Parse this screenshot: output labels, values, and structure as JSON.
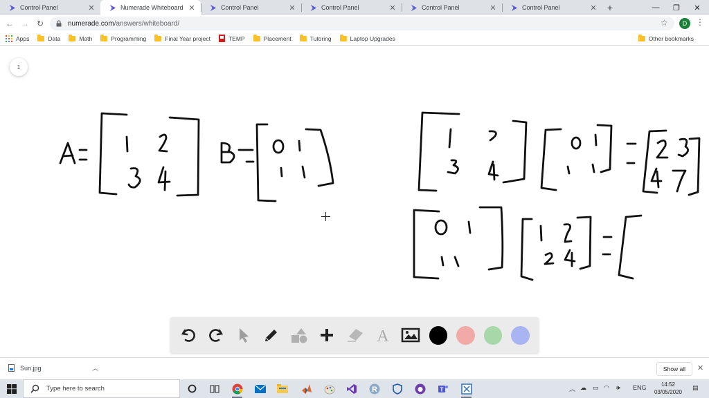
{
  "browser": {
    "tabs": [
      {
        "title": "Control Panel",
        "active": false
      },
      {
        "title": "Numerade Whiteboard",
        "active": true
      },
      {
        "title": "Control Panel",
        "active": false
      },
      {
        "title": "Control Panel",
        "active": false
      },
      {
        "title": "Control Panel",
        "active": false
      },
      {
        "title": "Control Panel",
        "active": false
      }
    ],
    "address": {
      "host": "numerade.com",
      "path": "/answers/whiteboard/"
    },
    "profile_initial": "D",
    "bookmarks": [
      {
        "label": "Apps",
        "icon": "apps-grid-icon"
      },
      {
        "label": "Data",
        "icon": "folder-icon"
      },
      {
        "label": "Math",
        "icon": "folder-icon"
      },
      {
        "label": "Programming",
        "icon": "folder-icon"
      },
      {
        "label": "Final Year project",
        "icon": "folder-icon"
      },
      {
        "label": "TEMP",
        "icon": "bookmark-icon"
      },
      {
        "label": "Placement",
        "icon": "folder-icon"
      },
      {
        "label": "Tutoring",
        "icon": "folder-icon"
      },
      {
        "label": "Laptop Upgrades",
        "icon": "folder-icon"
      }
    ],
    "other_bookmarks": "Other bookmarks"
  },
  "whiteboard": {
    "page_number": "1",
    "handwriting": {
      "matrix_a_label": "A",
      "matrix_a": [
        "1",
        "2",
        "3",
        "4"
      ],
      "matrix_b_label": "B",
      "matrix_b": [
        "0",
        "1",
        "1",
        "1"
      ],
      "product_ab_result": [
        "2",
        "3",
        "4",
        "7"
      ],
      "product_ba_left": [
        "0",
        "1",
        "1",
        "1"
      ],
      "product_ba_right": [
        "1",
        "2",
        "3",
        "4"
      ]
    },
    "tools": [
      {
        "name": "undo-icon",
        "enabled": true
      },
      {
        "name": "redo-icon",
        "enabled": true
      },
      {
        "name": "select-pointer-icon",
        "enabled": false
      },
      {
        "name": "pencil-icon",
        "enabled": true
      },
      {
        "name": "shapes-icon",
        "enabled": false
      },
      {
        "name": "plus-icon",
        "enabled": true
      },
      {
        "name": "eraser-icon",
        "enabled": false
      },
      {
        "name": "text-tool-icon",
        "enabled": false
      },
      {
        "name": "image-icon",
        "enabled": true
      }
    ],
    "colors": [
      "#000000",
      "#f2aaa7",
      "#a8d7aa",
      "#a9b4f2"
    ]
  },
  "downloads": {
    "file_name": "Sun.jpg",
    "show_all_label": "Show all"
  },
  "taskbar": {
    "search_placeholder": "Type here to search",
    "language": "ENG",
    "time": "14:52",
    "date": "03/05/2020"
  }
}
